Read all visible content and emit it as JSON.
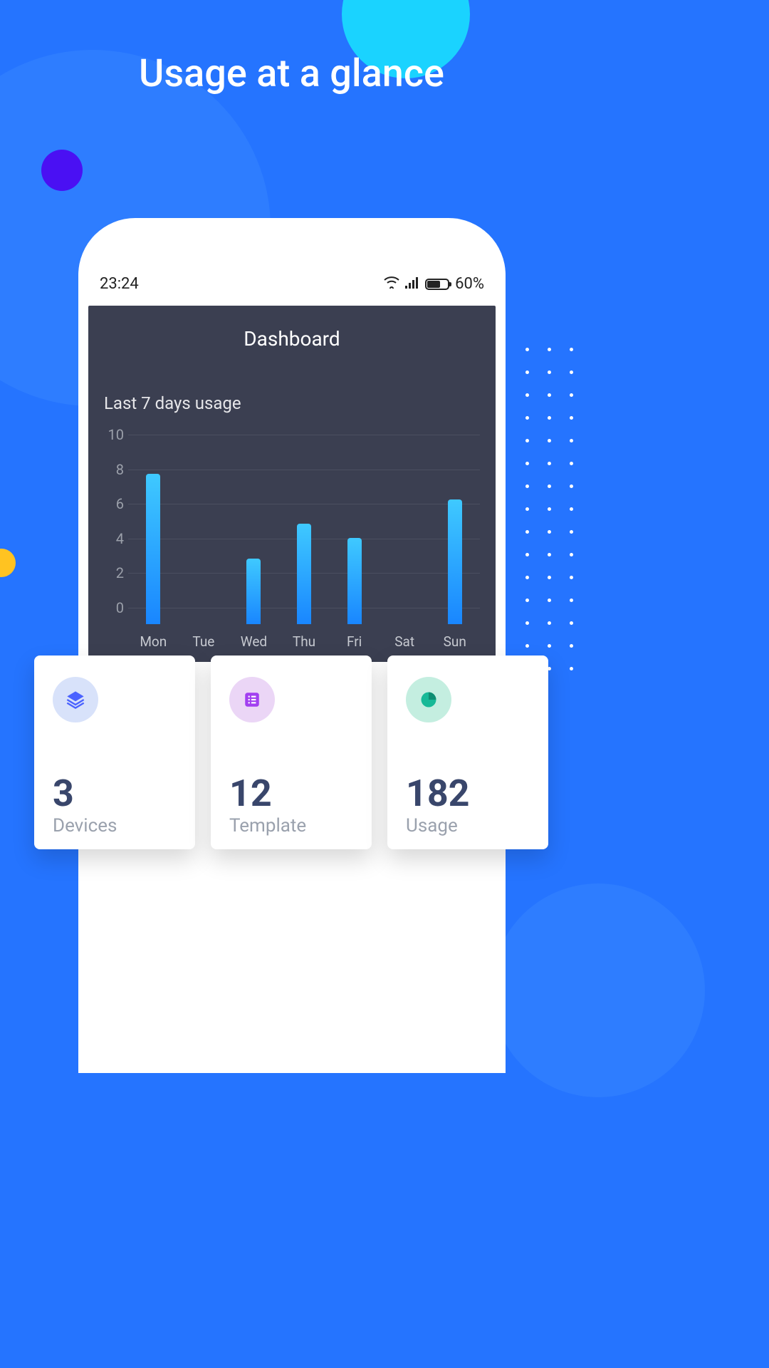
{
  "page_title": "Usage at a glance",
  "status_bar": {
    "time": "23:24",
    "battery_percent": "60%"
  },
  "dashboard": {
    "title": "Dashboard",
    "subtitle": "Last 7 days usage"
  },
  "chart_data": {
    "type": "bar",
    "title": "Last 7 days usage",
    "xlabel": "",
    "ylabel": "",
    "ylim": [
      0,
      10
    ],
    "y_ticks": [
      0,
      2,
      4,
      6,
      8,
      10
    ],
    "categories": [
      "Mon",
      "Tue",
      "Wed",
      "Thu",
      "Fri",
      "Sat",
      "Sun"
    ],
    "values": [
      8.7,
      0,
      3.8,
      5.8,
      5.0,
      0,
      7.2
    ]
  },
  "cards": [
    {
      "icon": "layers-icon",
      "color": "blue",
      "value": "3",
      "label": "Devices"
    },
    {
      "icon": "list-icon",
      "color": "purple",
      "value": "12",
      "label": "Template"
    },
    {
      "icon": "pie-icon",
      "color": "teal",
      "value": "182",
      "label": "Usage"
    }
  ]
}
